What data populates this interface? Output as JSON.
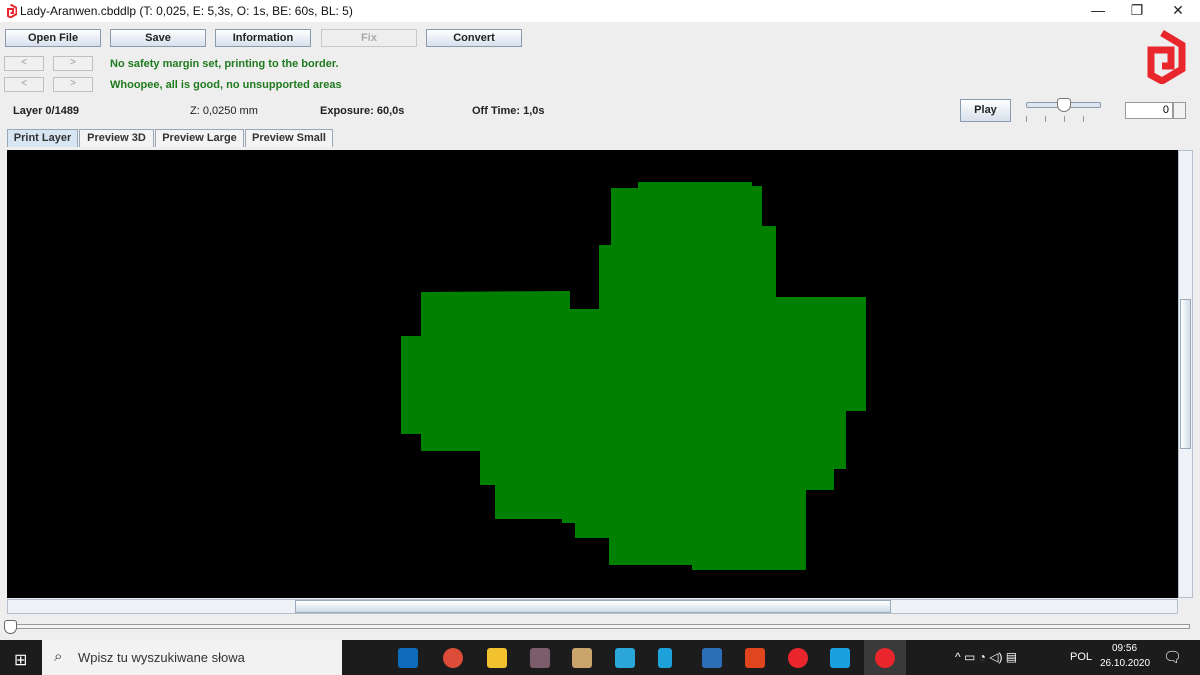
{
  "window": {
    "title": "Lady-Aranwen.cbddlp (T: 0,025, E: 5,3s, O: 1s, BE: 60s, BL: 5)",
    "minimize": "—",
    "restore": "❐",
    "close": "✕"
  },
  "toolbar": {
    "open_file": "Open File",
    "save": "Save",
    "information": "Information",
    "fix": "Fix",
    "convert": "Convert"
  },
  "nav": {
    "prev": "<",
    "next": ">"
  },
  "messages": {
    "margin": "No safety margin set, printing to the border.",
    "supports": "Whoopee, all is good, no unsupported areas"
  },
  "status": {
    "layer": "Layer 0/1489",
    "z": "Z: 0,0250 mm",
    "exposure": "Exposure: 60,0s",
    "off_time": "Off Time: 1,0s"
  },
  "playback": {
    "play": "Play",
    "speed_level": 0.5,
    "layer_value": "0"
  },
  "tabs": [
    {
      "label": "Print Layer",
      "active": true
    },
    {
      "label": "Preview 3D"
    },
    {
      "label": "Preview Large"
    },
    {
      "label": "Preview Small"
    }
  ],
  "layer_color": "#008000",
  "layer_slider_position": 0,
  "taskbar": {
    "search_placeholder": "Wpisz tu wyszukiwane słowa",
    "language": "POL",
    "time": "09:56",
    "date": "26.10.2020"
  },
  "brand_color": "#e8262c"
}
